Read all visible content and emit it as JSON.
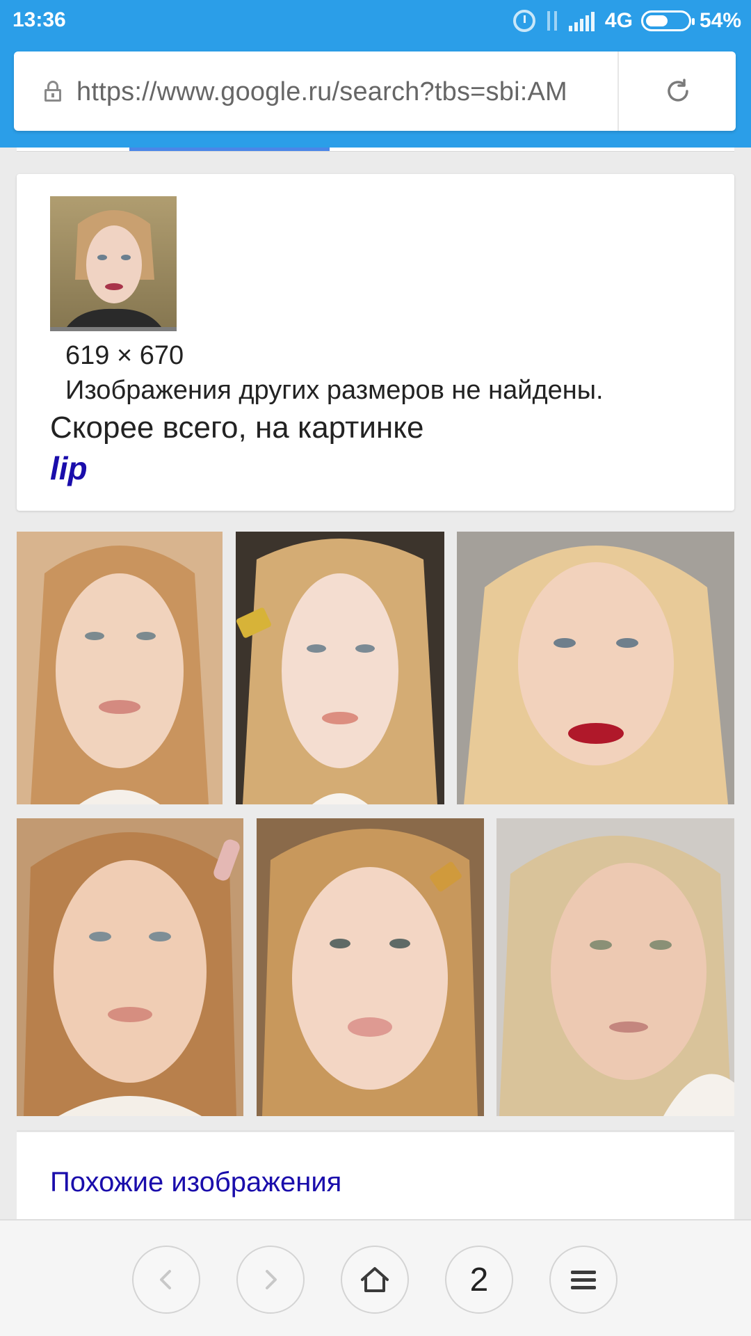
{
  "status_bar": {
    "time": "13:36",
    "network": "4G",
    "battery": "54%",
    "battery_level": 0.54,
    "icons": [
      "alarm-icon",
      "data-transfer-icon",
      "signal-icon",
      "battery-icon"
    ]
  },
  "address_bar": {
    "url": "https://www.google.ru/search?tbs=sbi:AM",
    "secure_icon": "lock-icon",
    "reload_icon": "reload-icon"
  },
  "image_info": {
    "dimensions": "619 × 670",
    "other_sizes_text": "Изображения других размеров не найдены.",
    "best_guess_text": "Скорее всего, на картинке",
    "best_guess_link": "lip"
  },
  "results_grid": {
    "rows": [
      [
        "result-image-1",
        "result-image-2",
        "result-image-3"
      ],
      [
        "result-image-4",
        "result-image-5",
        "result-image-6"
      ]
    ]
  },
  "similar_images": {
    "link_label": "Похожие изображения"
  },
  "bottom_nav": {
    "tab_count": "2",
    "icons": [
      "back-icon",
      "forward-icon",
      "home-icon",
      "tabs-icon",
      "menu-icon"
    ]
  },
  "colors": {
    "chrome_blue": "#2b9ee8",
    "link_blue": "#1a0dab",
    "tab_indicator": "#4a86e8"
  }
}
